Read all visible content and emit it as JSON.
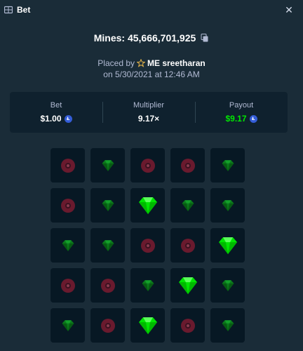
{
  "header": {
    "title": "Bet",
    "icon": "bet-ticket-icon",
    "close_icon": "close-icon"
  },
  "game": {
    "mines_label": "Mines: 45,666,701,925"
  },
  "placed": {
    "prefix": "Placed by",
    "user": "ME sreetharan",
    "user_badge_icon": "star-icon",
    "date": "on 5/30/2021 at 12:46 AM"
  },
  "stats": {
    "bet": {
      "label": "Bet",
      "value": "$1.00",
      "currency_icon": "litecoin-icon"
    },
    "multiplier": {
      "label": "Multiplier",
      "value": "9.17×"
    },
    "payout": {
      "label": "Payout",
      "value": "$9.17",
      "currency_icon": "litecoin-icon"
    }
  },
  "colors": {
    "background": "#1a2c38",
    "panel": "#0f212e",
    "tile": "#071824",
    "gem_revealed": "#00e701",
    "gem_dim": "#0b7a1c",
    "mine_dim": "#6a1a2e",
    "payout": "#00e701",
    "coin": "#345dd7"
  },
  "grid": {
    "rows": 5,
    "cols": 5,
    "tiles": [
      [
        "mine",
        "gem",
        "mine",
        "mine",
        "gem"
      ],
      [
        "mine",
        "gem",
        "gem-revealed",
        "gem",
        "gem"
      ],
      [
        "gem",
        "gem",
        "mine",
        "mine",
        "gem-revealed"
      ],
      [
        "mine",
        "mine",
        "gem",
        "gem-revealed",
        "gem"
      ],
      [
        "gem",
        "mine",
        "gem-revealed",
        "mine",
        "gem"
      ]
    ]
  }
}
